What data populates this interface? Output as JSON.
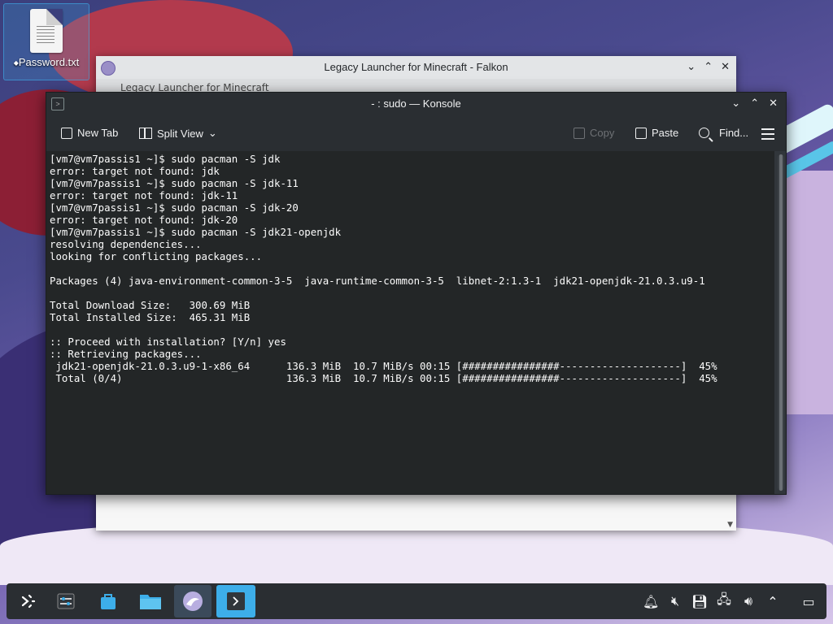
{
  "desktop": {
    "icons": [
      {
        "label": "Password.txt"
      }
    ]
  },
  "falkon": {
    "title": "Legacy Launcher for Minecraft - Falkon",
    "tab_label": "Legacy Launcher for Minecraft"
  },
  "konsole": {
    "title": "- : sudo — Konsole",
    "toolbar": {
      "new_tab": "New Tab",
      "split_view": "Split View",
      "copy": "Copy",
      "paste": "Paste",
      "find": "Find..."
    },
    "terminal_lines": [
      "[vm7@vm7passis1 ~]$ sudo pacman -S jdk",
      "error: target not found: jdk",
      "[vm7@vm7passis1 ~]$ sudo pacman -S jdk-11",
      "error: target not found: jdk-11",
      "[vm7@vm7passis1 ~]$ sudo pacman -S jdk-20",
      "error: target not found: jdk-20",
      "[vm7@vm7passis1 ~]$ sudo pacman -S jdk21-openjdk",
      "resolving dependencies...",
      "looking for conflicting packages...",
      "",
      "Packages (4) java-environment-common-3-5  java-runtime-common-3-5  libnet-2:1.3-1  jdk21-openjdk-21.0.3.u9-1",
      "",
      "Total Download Size:   300.69 MiB",
      "Total Installed Size:  465.31 MiB",
      "",
      ":: Proceed with installation? [Y/n] yes",
      ":: Retrieving packages...",
      " jdk21-openjdk-21.0.3.u9-1-x86_64      136.3 MiB  10.7 MiB/s 00:15 [################--------------------]  45%",
      " Total (0/4)                           136.3 MiB  10.7 MiB/s 00:15 [################--------------------]  45%"
    ]
  },
  "taskbar": {
    "items": [
      {
        "name": "app-launcher-icon",
        "active": false
      },
      {
        "name": "system-settings-icon",
        "active": false
      },
      {
        "name": "discover-store-icon",
        "active": false
      },
      {
        "name": "file-manager-icon",
        "active": false
      },
      {
        "name": "falkon-browser-icon",
        "active": true
      },
      {
        "name": "konsole-icon",
        "active": true
      }
    ],
    "tray": [
      "notifications-icon",
      "volume-muted-icon",
      "storage-icon",
      "network-icon",
      "volume-icon",
      "tray-expand-icon",
      "show-desktop-icon"
    ]
  },
  "colors": {
    "accent": "#3daee9",
    "terminal_bg": "#232627",
    "window_frame": "#2a2e32"
  }
}
